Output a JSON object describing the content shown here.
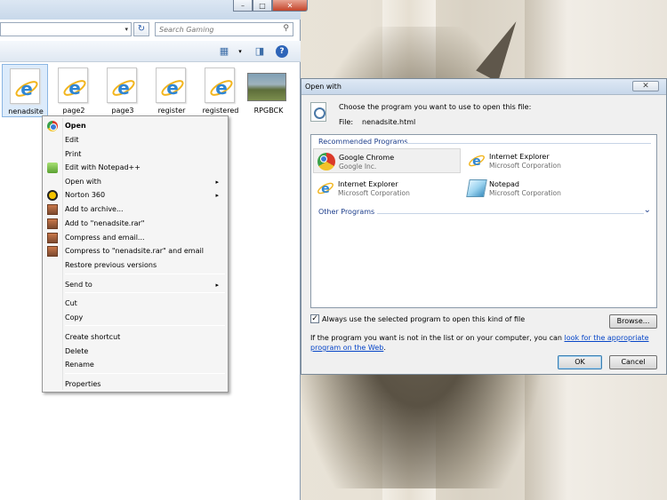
{
  "explorer": {
    "window_buttons": {
      "minimize": "–",
      "maximize": "□",
      "close": "✕"
    },
    "search": {
      "placeholder": "Search Gaming"
    },
    "files": [
      {
        "name": "nenadsite",
        "selected": true,
        "kind": "ie"
      },
      {
        "name": "page2",
        "selected": false,
        "kind": "ie"
      },
      {
        "name": "page3",
        "selected": false,
        "kind": "ie"
      },
      {
        "name": "register",
        "selected": false,
        "kind": "ie"
      },
      {
        "name": "registered",
        "selected": false,
        "kind": "ie"
      },
      {
        "name": "RPGBCK",
        "selected": false,
        "kind": "image"
      }
    ]
  },
  "context_menu": {
    "items": [
      {
        "label": "Open",
        "icon": "chrome-icon"
      },
      {
        "label": "Edit"
      },
      {
        "label": "Print"
      },
      {
        "label": "Edit with Notepad++",
        "icon": "notepad-plus-plus-icon"
      },
      {
        "label": "Open with",
        "arrow": "▸"
      },
      {
        "label": "Norton 360",
        "icon": "norton-icon",
        "arrow": "▸"
      },
      {
        "label": "Add to archive...",
        "icon": "winrar-icon"
      },
      {
        "label": "Add to \"nenadsite.rar\"",
        "icon": "winrar-icon"
      },
      {
        "label": "Compress and email...",
        "icon": "winrar-icon"
      },
      {
        "label": "Compress to \"nenadsite.rar\" and email",
        "icon": "winrar-icon"
      },
      {
        "label": "Restore previous versions"
      },
      {
        "label": "Send to",
        "arrow": "▸"
      },
      {
        "label": "Cut"
      },
      {
        "label": "Copy"
      },
      {
        "label": "Create shortcut"
      },
      {
        "label": "Delete"
      },
      {
        "label": "Rename"
      },
      {
        "label": "Properties"
      }
    ]
  },
  "dialog": {
    "title": "Open with",
    "close_label": "✕",
    "prompt": "Choose the program you want to use to open this file:",
    "file_label": "File:",
    "file_name": "nenadsite.html",
    "recommended_header": "Recommended Programs",
    "other_header": "Other Programs",
    "other_chevron": "⌄",
    "programs": [
      {
        "name": "Google Chrome",
        "company": "Google Inc.",
        "icon": "chrome-icon",
        "selected": true
      },
      {
        "name": "Internet Explorer",
        "company": "Microsoft Corporation",
        "icon": "internet-explorer-icon",
        "selected": false
      },
      {
        "name": "Internet Explorer",
        "company": "Microsoft Corporation",
        "icon": "internet-explorer-icon",
        "selected": false
      },
      {
        "name": "Notepad",
        "company": "Microsoft Corporation",
        "icon": "notepad-icon",
        "selected": false
      }
    ],
    "always_use_label": "Always use the selected program to open this kind of file",
    "always_use_checked": true,
    "browse_label": "Browse...",
    "info_text": "If the program you want is not in the list or on your computer, you can ",
    "info_link": "look for the appropriate program on the Web",
    "info_end": ".",
    "ok_label": "OK",
    "cancel_label": "Cancel"
  }
}
